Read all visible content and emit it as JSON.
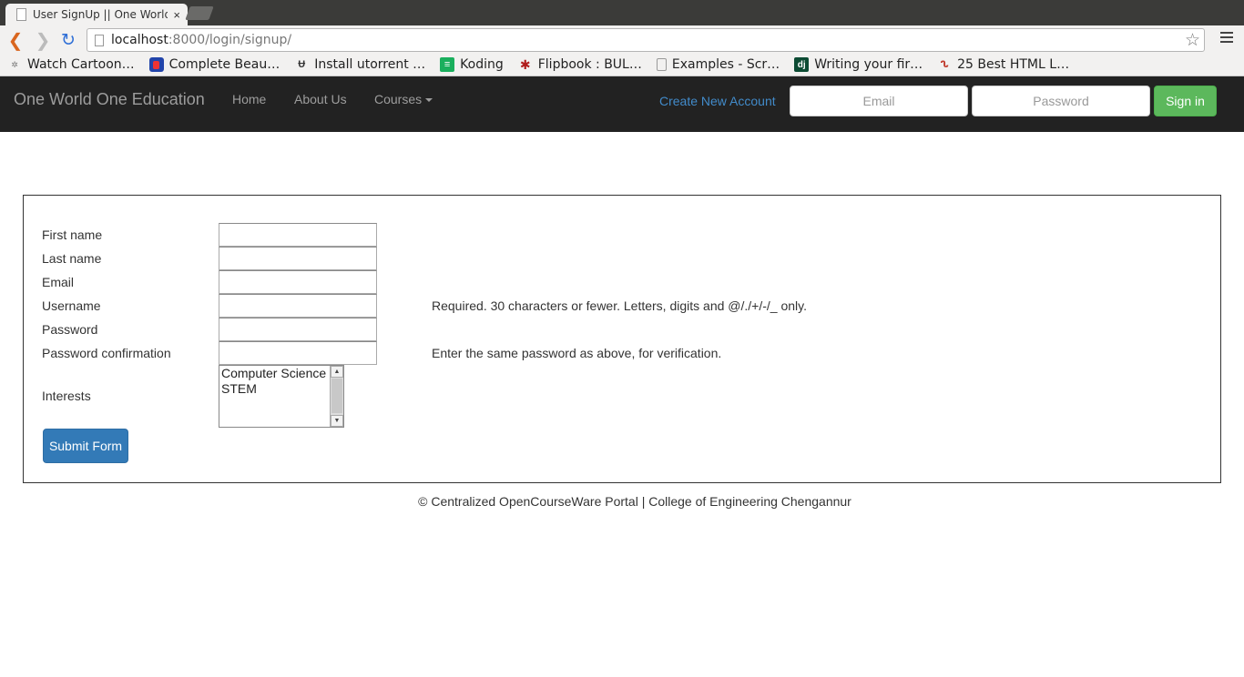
{
  "browser": {
    "tab_title": "User SignUp || One World,",
    "url_host": "localhost",
    "url_path": ":8000/login/signup/",
    "bookmarks": [
      {
        "label": "Watch Cartoon…",
        "icon": "watchcartoon-icon",
        "color": "#7a7a7a"
      },
      {
        "label": "Complete Beau…",
        "icon": "complete-beau-icon",
        "color": "#2244aa"
      },
      {
        "label": "Install utorrent …",
        "icon": "utorrent-icon",
        "color": "#333333"
      },
      {
        "label": "Koding",
        "icon": "koding-icon",
        "color": "#1aaf5d"
      },
      {
        "label": "Flipbook : BUL…",
        "icon": "flipbook-icon",
        "color": "#b01c1c"
      },
      {
        "label": "Examples - Scr…",
        "icon": "page-icon",
        "color": "#999999"
      },
      {
        "label": "Writing your fir…",
        "icon": "django-icon",
        "color": "#0c4b33"
      },
      {
        "label": "25 Best HTML L…",
        "icon": "html-icon",
        "color": "#c0392b"
      }
    ]
  },
  "navbar": {
    "brand": "One World One Education",
    "links": [
      "Home",
      "About Us",
      "Courses"
    ],
    "create_account": "Create New Account",
    "email_placeholder": "Email",
    "password_placeholder": "Password",
    "signin_label": "Sign in"
  },
  "form": {
    "fields": [
      {
        "label": "First name",
        "value": ""
      },
      {
        "label": "Last name",
        "value": ""
      },
      {
        "label": "Email",
        "value": ""
      },
      {
        "label": "Username",
        "value": "",
        "help": "Required. 30 characters or fewer. Letters, digits and @/./+/-/_ only."
      },
      {
        "label": "Password",
        "value": ""
      },
      {
        "label": "Password confirmation",
        "value": "",
        "help": "Enter the same password as above, for verification."
      }
    ],
    "interests_label": "Interests",
    "interests_options": [
      "Computer Science",
      "STEM"
    ],
    "submit_label": "Submit Form"
  },
  "footer": "© Centralized OpenCourseWare Portal | College of Engineering Chengannur",
  "colors": {
    "navbar_bg": "#222222",
    "link_blue": "#428bca",
    "signin_green": "#5cb85c",
    "submit_blue": "#337ab7"
  }
}
